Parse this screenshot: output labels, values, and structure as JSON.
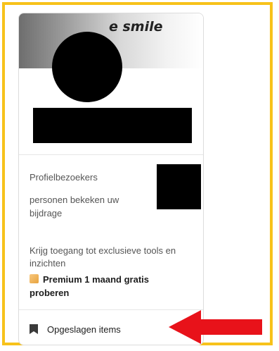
{
  "banner": {
    "text": "e smile"
  },
  "insights": {
    "visitors_label": "Profielbezoekers",
    "viewers_label": "personen bekeken uw bijdrage"
  },
  "premium": {
    "promo_text": "Krijg toegang tot exclusieve tools en inzichten",
    "link_label": "Premium 1 maand gratis proberen"
  },
  "saved_items": {
    "label": "Opgeslagen items"
  },
  "colors": {
    "highlight_frame": "#f7c21b",
    "arrow": "#e8121a",
    "premium_icon": "#e7a33e"
  },
  "icons": [
    "bookmark-icon",
    "premium-icon",
    "red-arrow-icon"
  ]
}
